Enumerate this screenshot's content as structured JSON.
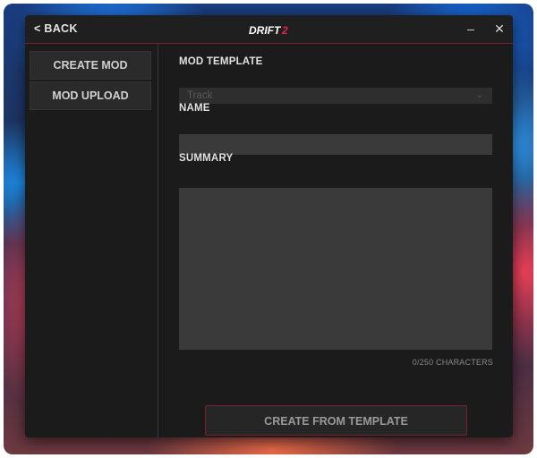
{
  "header": {
    "back_label": "< BACK",
    "logo_text": "DRIFT",
    "logo_number": "2",
    "minimize_glyph": "–",
    "close_glyph": "✕"
  },
  "sidebar": {
    "items": [
      {
        "label": "CREATE MOD"
      },
      {
        "label": "MOD UPLOAD"
      }
    ]
  },
  "form": {
    "template_label": "MOD TEMPLATE",
    "template_value": "Track",
    "name_label": "NAME",
    "name_value": "",
    "summary_label": "SUMMARY",
    "summary_value": "",
    "char_count": "0/250 CHARACTERS",
    "submit_label": "CREATE FROM TEMPLATE"
  },
  "colors": {
    "accent": "#7a1e33",
    "window_bg": "#1b1b1c",
    "field_bg": "#3a3a3b"
  }
}
